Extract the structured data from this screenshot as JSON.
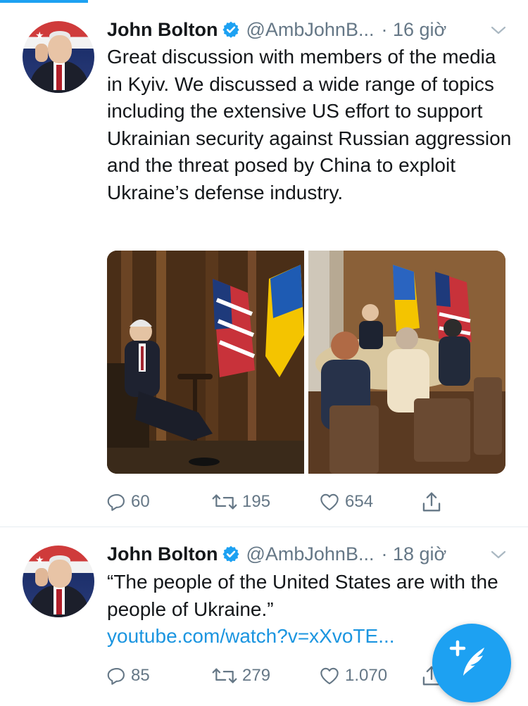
{
  "colors": {
    "accent": "#1da1f2",
    "link": "#1b95e0",
    "text_primary": "#14171a",
    "text_secondary": "#657786"
  },
  "tweets": [
    {
      "author_name": "John Bolton",
      "handle": "@AmbJohnB...",
      "time": "· 16 giờ",
      "verified": true,
      "text": "Great discussion with members of the media in Kyiv. We discussed a wide range of topics including the extensive US effort to support Ukrainian security against Russian aggression and the threat posed by China to exploit Ukraine’s defense industry.",
      "actions": {
        "replies": "60",
        "retweets": "195",
        "likes": "654"
      },
      "icons": [
        "reply-icon",
        "retweet-icon",
        "like-icon",
        "share-icon"
      ]
    },
    {
      "author_name": "John Bolton",
      "handle": "@AmbJohnB...",
      "time": "· 18 giờ",
      "verified": true,
      "text": "“The people of the United States are with the people of Ukraine.”",
      "link": "youtube.com/watch?v=xXvoTE...",
      "actions": {
        "replies": "85",
        "retweets": "279",
        "likes": "1.070"
      },
      "icons": [
        "reply-icon",
        "retweet-icon",
        "like-icon",
        "share-icon"
      ]
    }
  ],
  "fab": {
    "icon": "compose-tweet-icon"
  }
}
